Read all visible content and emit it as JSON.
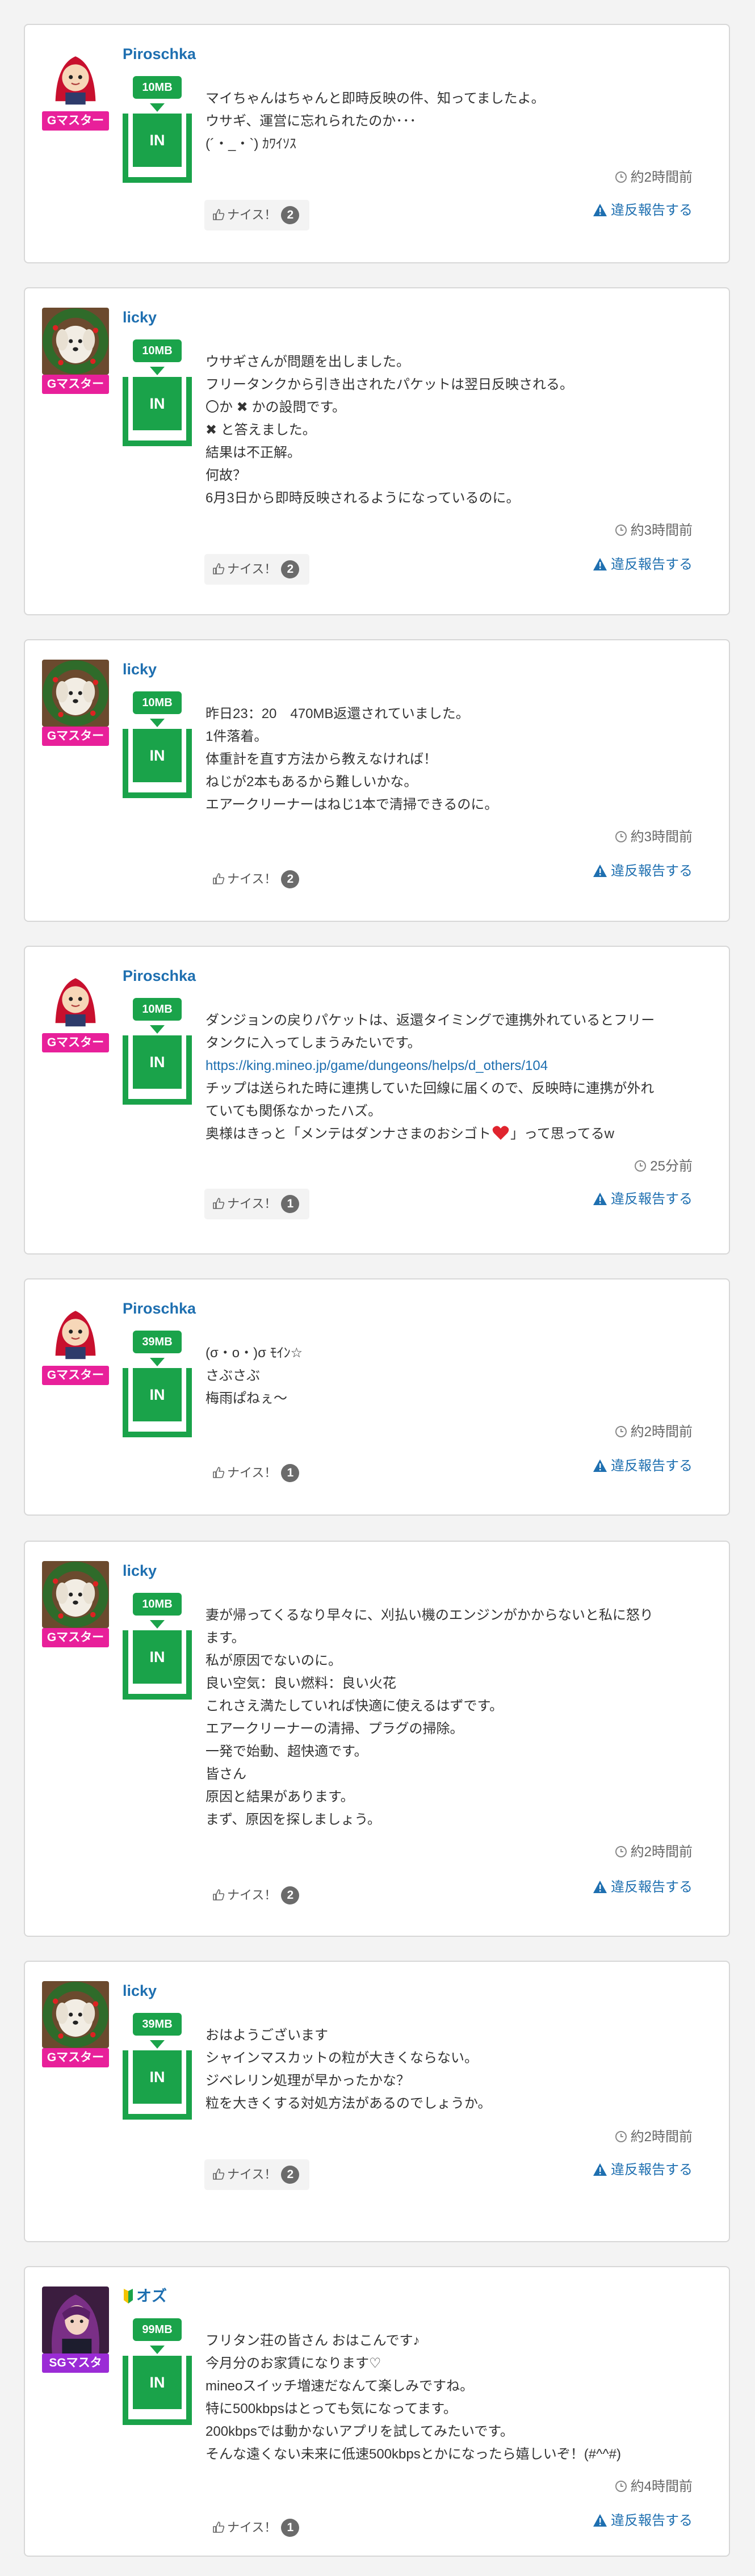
{
  "colors": {
    "accent_link": "#1e6fb0",
    "packet_green": "#1aa34a",
    "gmaster_pink": "#e8209a",
    "sgmaster_purple": "#9b2bd6",
    "count_badge": "#6b6b6b"
  },
  "posts": [
    {
      "user": "Piroschka",
      "avatar": "red-hood-illustration",
      "rank": "Gマスター",
      "packet": "10MB",
      "in_label": "IN",
      "lines": [
        "マイちゃんはちゃんと即時反映の件、知ってましたよ。",
        "ウサギ、運営に忘れられたのか･･･",
        "(´・_・`) ｶﾜｲｿｽ"
      ],
      "time": "約2時間前",
      "like_label": "ナイス！",
      "likes": "2",
      "report_label": "違反報告する"
    },
    {
      "user": "licky",
      "avatar": "white-dog-with-wreath",
      "rank": "Gマスター",
      "packet": "10MB",
      "in_label": "IN",
      "lines": [
        "ウサギさんが問題を出しました。",
        "フリータンクから引き出されたパケットは翌日反映される。",
        "〇か ✖ かの設問です。",
        "✖ と答えました。",
        "結果は不正解。",
        "何故？",
        "6月3日から即時反映されるようになっているのに。"
      ],
      "time": "約3時間前",
      "like_label": "ナイス！",
      "likes": "2",
      "report_label": "違反報告する"
    },
    {
      "user": "licky",
      "avatar": "white-dog-with-wreath",
      "rank": "Gマスター",
      "packet": "10MB",
      "in_label": "IN",
      "lines": [
        "昨日23：20　470MB返還されていました。",
        "1件落着。",
        "体重計を直す方法から教えなければ！",
        "ねじが2本もあるから難しいかな。",
        "エアークリーナーはねじ1本で清掃できるのに。"
      ],
      "time": "約3時間前",
      "like_label": "ナイス！",
      "likes": "2",
      "report_label": "違反報告する"
    },
    {
      "user": "Piroschka",
      "avatar": "red-hood-illustration",
      "rank": "Gマスター",
      "packet": "10MB",
      "in_label": "IN",
      "lines": [
        "ダンジョンの戻りパケットは、返還タイミングで連携外れているとフリー",
        "タンクに入ってしまうみたいです。"
      ],
      "link": "https://king.mineo.jp/game/dungeons/helps/d_others/104",
      "lines_after": [
        "チップは送られた時に連携していた回線に届くので、反映時に連携が外れ",
        "ていても関係なかったハズ。"
      ],
      "heart_before": "奥様はきっと「メンテはダンナさまのおシゴト",
      "heart_after": "」って思ってるw",
      "time": "25分前",
      "like_label": "ナイス！",
      "likes": "1",
      "report_label": "違反報告する"
    },
    {
      "user": "Piroschka",
      "avatar": "red-hood-illustration",
      "rank": "Gマスター",
      "packet": "39MB",
      "in_label": "IN",
      "lines": [
        "(σ・o・)σ ﾓｲﾝ☆",
        "さぶさぶ",
        "梅雨ぱねぇ〜"
      ],
      "time": "約2時間前",
      "like_label": "ナイス！",
      "likes": "1",
      "report_label": "違反報告する"
    },
    {
      "user": "licky",
      "avatar": "white-dog-with-wreath",
      "rank": "Gマスター",
      "packet": "10MB",
      "in_label": "IN",
      "lines": [
        "妻が帰ってくるなり早々に、刈払い機のエンジンがかからないと私に怒り",
        "ます。",
        "私が原因でないのに。",
        "良い空気：良い燃料：良い火花",
        "これさえ満たしていれば快適に使えるはずです。",
        "エアークリーナーの清掃、プラグの掃除。",
        "一発で始動、超快適です。",
        "皆さん",
        "原因と結果があります。",
        "まず、原因を探しましょう。"
      ],
      "time": "約2時間前",
      "like_label": "ナイス！",
      "likes": "2",
      "report_label": "違反報告する"
    },
    {
      "user": "licky",
      "avatar": "white-dog-with-wreath",
      "rank": "Gマスター",
      "packet": "39MB",
      "in_label": "IN",
      "lines": [
        "おはようございます",
        "シャインマスカットの粒が大きくならない。",
        "ジベレリン処理が早かったかな？",
        "粒を大きくする対処方法があるのでしょうか。"
      ],
      "time": "約2時間前",
      "like_label": "ナイス！",
      "likes": "2",
      "report_label": "違反報告する"
    },
    {
      "user": "オズ",
      "avatar": "purple-hair-character",
      "rank": "SGマスタ",
      "packet": "99MB",
      "in_label": "IN",
      "lines": [
        "フリタン荘の皆さん おはこんです♪",
        "今月分のお家賃になります♡",
        "mineoスイッチ増速だなんて楽しみですね。",
        "特に500kbpsはとっても気になってます。",
        "200kbpsでは動かないアプリを試してみたいです。",
        "そんな遠くない未来に低速500kbpsとかになったら嬉しいぞ！(#^^#)"
      ],
      "time": "約4時間前",
      "like_label": "ナイス！",
      "likes": "1",
      "report_label": "違反報告する"
    }
  ]
}
